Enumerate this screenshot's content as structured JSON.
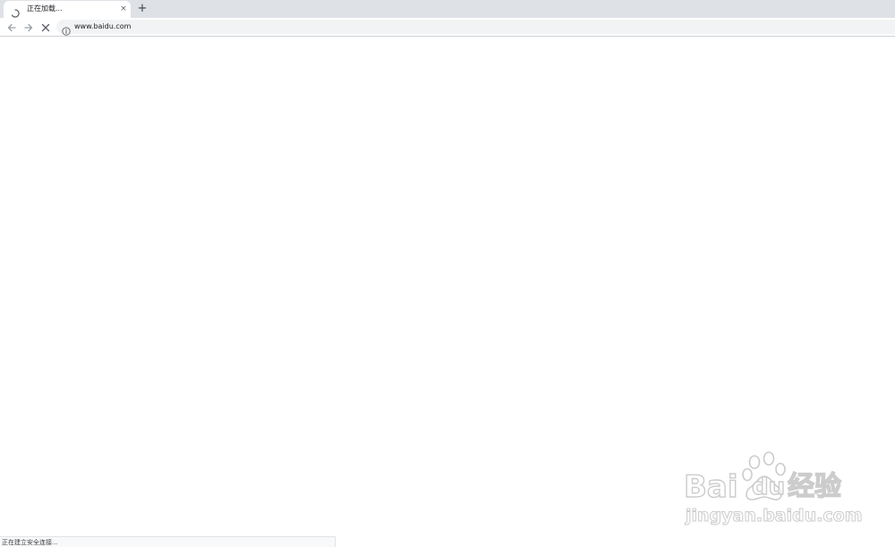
{
  "tab": {
    "title": "正在加载...",
    "close_glyph": "×",
    "spinner_icon": "loading-spinner-icon"
  },
  "tabstrip": {
    "new_tab_glyph": "+"
  },
  "toolbar": {
    "back_icon": "arrow-left-icon",
    "forward_icon": "arrow-right-icon",
    "stop_icon": "close-icon",
    "info_icon": "info-icon"
  },
  "omnibox": {
    "url": "www.baidu.com"
  },
  "status": {
    "text": "正在建立安全连接..."
  },
  "watermark": {
    "brand_bai": "Bai",
    "brand_du": "du",
    "brand_jingyan": "经验",
    "domain": "jingyan.baidu.com"
  },
  "colors": {
    "tabstrip_bg": "#dee1e6",
    "omnibox_bg": "#f1f3f4",
    "icon_gray": "#5f6368",
    "watermark_stroke": "#cccccc"
  }
}
